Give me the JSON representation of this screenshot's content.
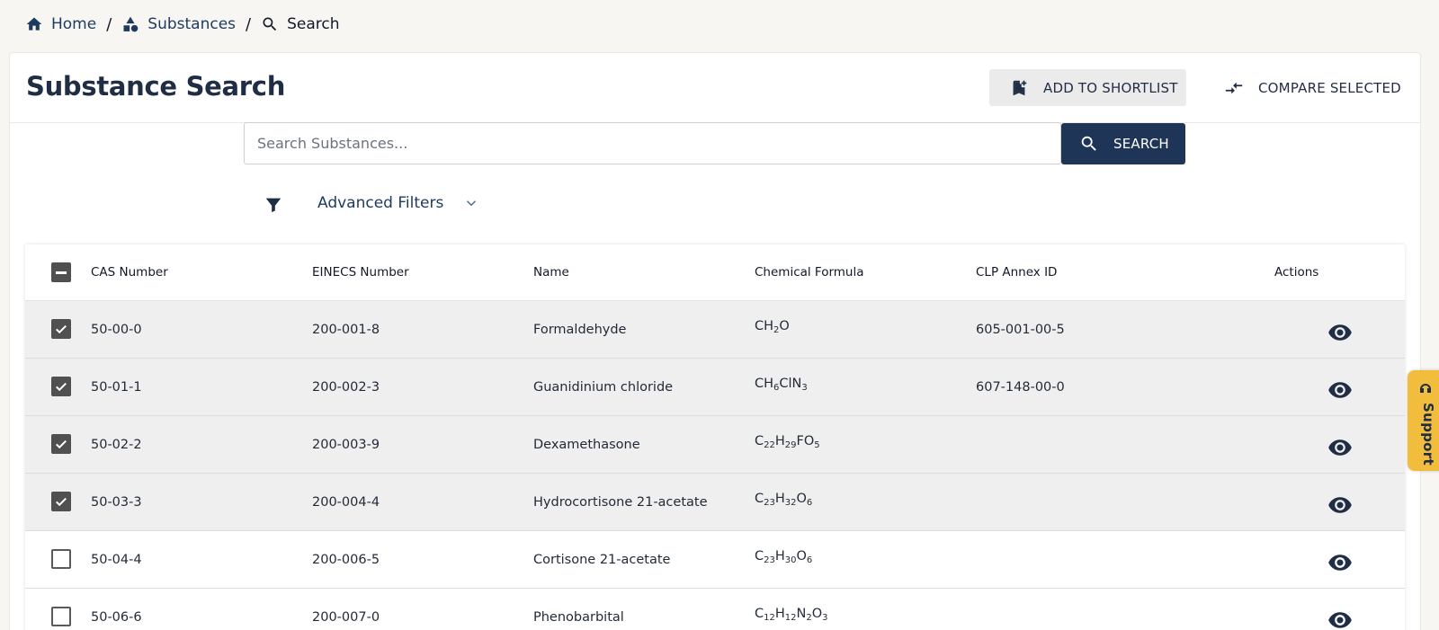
{
  "breadcrumb": {
    "home": "Home",
    "substances": "Substances",
    "current": "Search",
    "separator": "/"
  },
  "header": {
    "title": "Substance Search",
    "add_shortlist_label": "ADD TO SHORTLIST",
    "compare_label": "COMPARE SELECTED"
  },
  "search": {
    "placeholder": "Search Substances...",
    "value": "",
    "button_label": "SEARCH"
  },
  "filters": {
    "label": "Advanced Filters"
  },
  "table": {
    "columns": {
      "cas": "CAS Number",
      "einecs": "EINECS Number",
      "name": "Name",
      "formula": "Chemical Formula",
      "clp": "CLP Annex ID",
      "actions": "Actions"
    },
    "header_checkbox_state": "indeterminate",
    "rows": [
      {
        "selected": true,
        "cas": "50-00-0",
        "einecs": "200-001-8",
        "name": "Formaldehyde",
        "formula": [
          [
            "CH",
            ""
          ],
          [
            "2",
            "sub"
          ],
          [
            "O",
            ""
          ]
        ],
        "clp": "605-001-00-5"
      },
      {
        "selected": true,
        "cas": "50-01-1",
        "einecs": "200-002-3",
        "name": "Guanidinium chloride",
        "formula": [
          [
            "CH",
            ""
          ],
          [
            "6",
            "sub"
          ],
          [
            "ClN",
            ""
          ],
          [
            "3",
            "sub"
          ]
        ],
        "clp": "607-148-00-0"
      },
      {
        "selected": true,
        "cas": "50-02-2",
        "einecs": "200-003-9",
        "name": "Dexamethasone",
        "formula": [
          [
            "C",
            ""
          ],
          [
            "22",
            "sub"
          ],
          [
            "H",
            ""
          ],
          [
            "29",
            "sub"
          ],
          [
            "FO",
            ""
          ],
          [
            "5",
            "sub"
          ]
        ],
        "clp": ""
      },
      {
        "selected": true,
        "cas": "50-03-3",
        "einecs": "200-004-4",
        "name": "Hydrocortisone 21-acetate",
        "formula": [
          [
            "C",
            ""
          ],
          [
            "23",
            "sub"
          ],
          [
            "H",
            ""
          ],
          [
            "32",
            "sub"
          ],
          [
            "O",
            ""
          ],
          [
            "6",
            "sub"
          ]
        ],
        "clp": ""
      },
      {
        "selected": false,
        "cas": "50-04-4",
        "einecs": "200-006-5",
        "name": "Cortisone 21-acetate",
        "formula": [
          [
            "C",
            ""
          ],
          [
            "23",
            "sub"
          ],
          [
            "H",
            ""
          ],
          [
            "30",
            "sub"
          ],
          [
            "O",
            ""
          ],
          [
            "6",
            "sub"
          ]
        ],
        "clp": ""
      },
      {
        "selected": false,
        "cas": "50-06-6",
        "einecs": "200-007-0",
        "name": "Phenobarbital",
        "formula": [
          [
            "C",
            ""
          ],
          [
            "12",
            "sub"
          ],
          [
            "H",
            ""
          ],
          [
            "12",
            "sub"
          ],
          [
            "N",
            ""
          ],
          [
            "2",
            "sub"
          ],
          [
            "O",
            ""
          ],
          [
            "3",
            "sub"
          ]
        ],
        "clp": ""
      }
    ]
  },
  "support": {
    "label": "Support"
  },
  "icons": {
    "breadcrumb_home": "home-icon",
    "breadcrumb_substances": "shapes-icon",
    "breadcrumb_search": "search-icon",
    "shortlist": "bookmark-add-icon",
    "compare": "compare-arrows-icon",
    "search_button": "search-icon",
    "filter": "filter-icon",
    "filters_expand": "chevron-down-icon",
    "row_action": "eye-icon",
    "support": "support-icon"
  },
  "colors": {
    "primary": "#1f3558",
    "link": "#1e3a5f",
    "page_background": "#f8f6f2",
    "selected_row": "#efefef",
    "checkbox": "#505050",
    "support_tab": "#f2bd3d"
  }
}
